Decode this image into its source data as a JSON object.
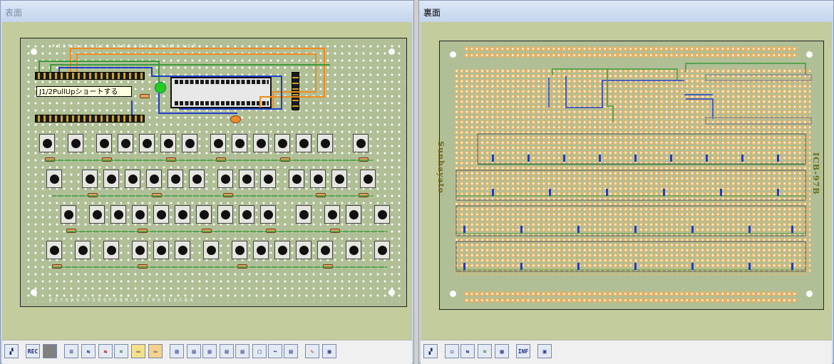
{
  "left_window": {
    "title": "表面",
    "tooltip": "J1/2PullUpショートする",
    "top_row_labels": "@ZYXWVUTSRQPONMLKJIHGFEDCBA",
    "left_col_labels": "63 62 61 60 59 58 57 56 55 54 53 52 51 50 49 48 47 46 45 44 43 42 41 40 39 38 37 36 35 34 33 32 31 30 29 28 27 26 25 24 23 22 21 20 19 18 17 16 15 14 13 12 11 10 9 8 7 6 5 4 3 2 1",
    "toolbar": [
      {
        "name": "select-icon",
        "label": "▞"
      },
      {
        "name": "rec-button",
        "label": "REC"
      },
      {
        "name": "stop-button",
        "label": ""
      },
      {
        "name": "part-icon",
        "label": "⊡"
      },
      {
        "name": "wire-blue-icon",
        "label": "⇆"
      },
      {
        "name": "wire-red-icon",
        "label": "⇆"
      },
      {
        "name": "wire-green-icon",
        "label": "≈"
      },
      {
        "name": "pad-yellow-icon",
        "label": "▭"
      },
      {
        "name": "pad-orange-icon",
        "label": "▭"
      },
      {
        "name": "grid-icon",
        "label": "▧"
      },
      {
        "name": "layer-1-icon",
        "label": "▤"
      },
      {
        "name": "layer-2-icon",
        "label": "▤"
      },
      {
        "name": "layer-3-icon",
        "label": "▤"
      },
      {
        "name": "layer-4-icon",
        "label": "▤"
      },
      {
        "name": "layer-5-icon",
        "label": "▢"
      },
      {
        "name": "layer-6-icon",
        "label": "⋯"
      },
      {
        "name": "layer-7-icon",
        "label": "▤"
      },
      {
        "name": "pen-icon",
        "label": "✎"
      },
      {
        "name": "view-icon",
        "label": "▣"
      }
    ]
  },
  "right_window": {
    "title": "裏面",
    "board_maker_label": "Sunhayato",
    "board_model_label": "ICB-97B",
    "toolbar": [
      {
        "name": "select-icon",
        "label": "▞"
      },
      {
        "name": "pointer-icon",
        "label": "◻"
      },
      {
        "name": "wire-icon",
        "label": "⇆"
      },
      {
        "name": "wire-green-icon",
        "label": "≈"
      },
      {
        "name": "layer-icon",
        "label": "▦"
      },
      {
        "name": "info-icon",
        "label": "INF"
      },
      {
        "name": "view-icon",
        "label": "▣"
      }
    ]
  },
  "colors": {
    "board_green": "#b0bf96",
    "client_bg": "#c3cc9c",
    "wire_blue": "#1d3ec9",
    "wire_orange": "#f28a1c",
    "wire_green": "#3c9a3c",
    "pad_orange": "#f2ae58"
  }
}
